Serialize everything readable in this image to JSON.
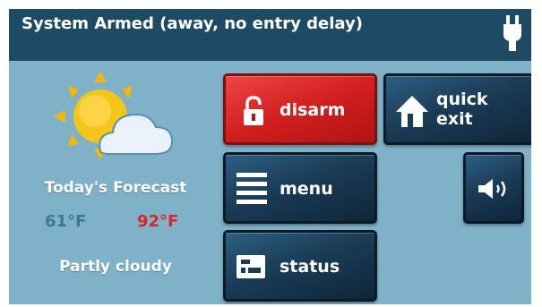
{
  "status_bar": {
    "text": "System Armed (away, no entry delay)",
    "power_icon": "plug-icon"
  },
  "weather": {
    "icon": "partly-cloudy-icon",
    "title": "Today's Forecast",
    "low": "61°F",
    "high": "92°F",
    "conditions": "Partly cloudy"
  },
  "buttons": {
    "disarm": {
      "label": "disarm",
      "icon": "unlocked-padlock-icon"
    },
    "quick_exit": {
      "line1": "quick",
      "line2": "exit",
      "icon": "house-exit-icon"
    },
    "menu": {
      "label": "menu",
      "icon": "menu-lines-icon"
    },
    "volume": {
      "icon": "speaker-icon"
    },
    "status": {
      "label": "status",
      "icon": "status-panel-icon"
    }
  },
  "colors": {
    "panel_background": "#7fb2c9",
    "status_bar": "#1f4a64",
    "disarm_button": "#d21f1f",
    "nav_button": "#1a3c57",
    "temp_low": "#3f7897",
    "temp_high": "#d92525",
    "sun": "#f5c518",
    "cloud": "#e9f2f8"
  }
}
